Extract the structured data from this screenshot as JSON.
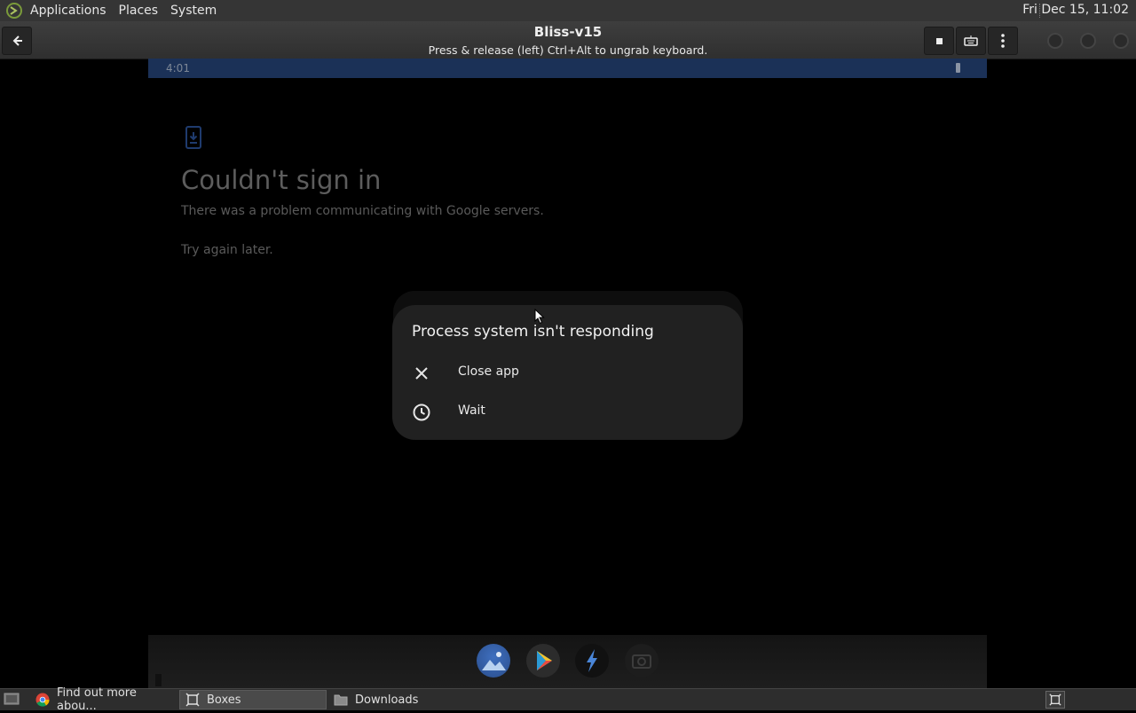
{
  "top_panel": {
    "menus": [
      "Applications",
      "Places",
      "System"
    ],
    "clock": "Fri Dec 15, 11:02"
  },
  "header": {
    "title": "Bliss-v15",
    "subtitle": "Press & release (left) Ctrl+Alt to ungrab keyboard."
  },
  "android": {
    "status_time": "4:01",
    "signin_title": "Couldn't sign in",
    "signin_desc": "There was a problem communicating with Google servers.",
    "signin_retry": "Try again later.",
    "dialog": {
      "title": "Process system isn't responding",
      "options": [
        {
          "label": "Close app",
          "icon": "close-icon"
        },
        {
          "label": "Wait",
          "icon": "clock-icon"
        }
      ]
    },
    "dock_apps": [
      "gallery-icon",
      "play-store-icon",
      "bolt-app-icon",
      "camera-icon"
    ]
  },
  "taskbar": {
    "tasks": [
      {
        "label": "Find out more abou...",
        "icon": "chrome-icon"
      },
      {
        "label": "Boxes",
        "icon": "boxes-icon"
      },
      {
        "label": "Downloads",
        "icon": "folder-icon"
      }
    ]
  },
  "colors": {
    "status_bar": "#1b3157",
    "dialog_bg": "#212121",
    "panel_bg": "#353535"
  }
}
